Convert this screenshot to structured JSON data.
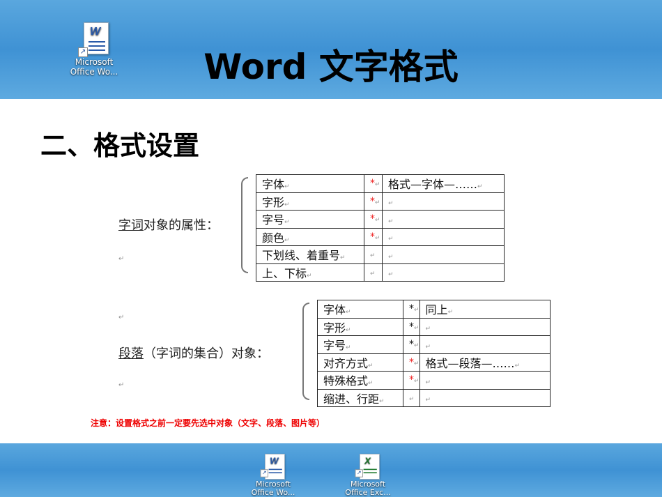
{
  "header": {
    "title": "Word 文字格式",
    "icon_label_1": "Microsoft",
    "icon_label_2": "Office Wo..."
  },
  "heading": "二、格式设置",
  "section1": {
    "label_underlined": "字词",
    "label_rest": "对象的属性：",
    "rows": [
      {
        "name": "字体",
        "star": "*",
        "star_red": true,
        "note": "格式—字体—……"
      },
      {
        "name": "字形",
        "star": "*",
        "star_red": true,
        "note": ""
      },
      {
        "name": "字号",
        "star": "*",
        "star_red": true,
        "note": ""
      },
      {
        "name": "颜色",
        "star": "*",
        "star_red": true,
        "note": ""
      },
      {
        "name": "下划线、着重号",
        "star": "",
        "star_red": false,
        "note": ""
      },
      {
        "name": "上、下标",
        "star": "",
        "star_red": false,
        "note": ""
      }
    ]
  },
  "section2": {
    "label_underlined": "段落",
    "label_rest": "（字词的集合）对象：",
    "rows": [
      {
        "name": "字体",
        "star": "*",
        "star_red": false,
        "note": "同上"
      },
      {
        "name": "字形",
        "star": "*",
        "star_red": false,
        "note": ""
      },
      {
        "name": "字号",
        "star": "*",
        "star_red": false,
        "note": ""
      },
      {
        "name": "对齐方式",
        "star": "*",
        "star_red": true,
        "note": "格式—段落—……"
      },
      {
        "name": "特殊格式",
        "star": "*",
        "star_red": true,
        "note": ""
      },
      {
        "name": "缩进、行距",
        "star": "",
        "star_red": false,
        "note": ""
      }
    ]
  },
  "note": "注意：设置格式之前一定要先选中对象（文字、段落、图片等）",
  "taskbar": {
    "word": {
      "l1": "Microsoft",
      "l2": "Office Wo..."
    },
    "excel": {
      "l1": "Microsoft",
      "l2": "Office Exc..."
    }
  },
  "return_mark": "↵"
}
